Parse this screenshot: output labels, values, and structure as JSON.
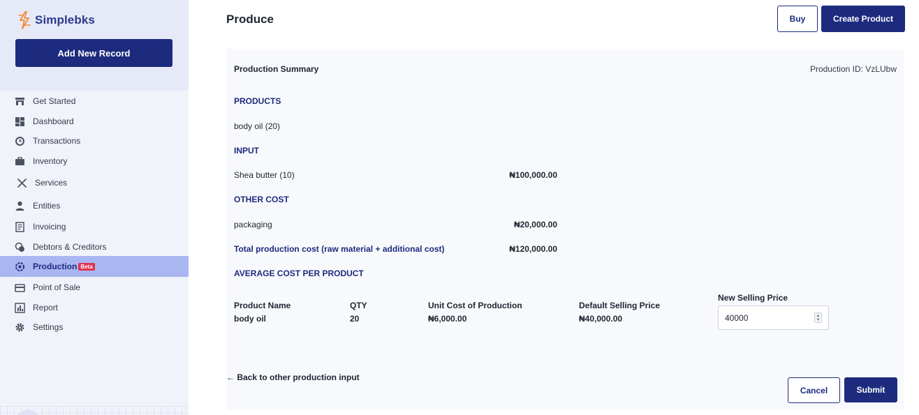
{
  "app": {
    "name": "Simplebks"
  },
  "sidebar": {
    "add_record_label": "Add New Record",
    "items": [
      {
        "label": "Get Started",
        "icon": "store-icon"
      },
      {
        "label": "Dashboard",
        "icon": "dashboard-icon"
      },
      {
        "label": "Transactions",
        "icon": "history-icon"
      },
      {
        "label": "Inventory",
        "icon": "briefcase-icon"
      },
      {
        "label": "Services",
        "icon": "tools-icon"
      },
      {
        "label": "Entities",
        "icon": "person-icon"
      },
      {
        "label": "Invoicing",
        "icon": "invoice-icon"
      },
      {
        "label": "Debtors & Creditors",
        "icon": "coins-icon"
      },
      {
        "label": "Production",
        "icon": "production-icon",
        "badge": "Beta",
        "active": true
      },
      {
        "label": "Point of Sale",
        "icon": "card-icon"
      },
      {
        "label": "Report",
        "icon": "report-icon"
      },
      {
        "label": "Settings",
        "icon": "gear-icon"
      }
    ]
  },
  "header": {
    "title": "Produce",
    "buy_label": "Buy",
    "create_label": "Create Product"
  },
  "summary": {
    "title": "Production Summary",
    "production_id": "Production ID: VzLUbw",
    "products_heading": "PRODUCTS",
    "product_line": "body oil (20)",
    "input_heading": "INPUT",
    "input_item": "Shea butter (10)",
    "input_amount": "₦100,000.00",
    "other_cost_heading": "OTHER COST",
    "other_cost_item": "packaging",
    "other_cost_amount": "₦20,000.00",
    "total_label": "Total production cost (raw material + additional cost)",
    "total_amount": "₦120,000.00",
    "average_heading": "AVERAGE COST PER PRODUCT"
  },
  "table": {
    "headers": [
      "Product Name",
      "QTY",
      "Unit Cost of Production",
      "Default Selling Price",
      "New Selling Price"
    ],
    "row": {
      "name": "body oil",
      "qty": "20",
      "unit_cost": "₦6,000.00",
      "default_price": "₦40,000.00",
      "new_price": "40000"
    }
  },
  "footer": {
    "back_label": "← Back to other production input",
    "cancel_label": "Cancel",
    "submit_label": "Submit"
  },
  "colors": {
    "primary": "#1c2b7e",
    "active_nav": "#aab6f1",
    "beta_badge": "#e0344f",
    "logo_accent": "#f28b30"
  }
}
